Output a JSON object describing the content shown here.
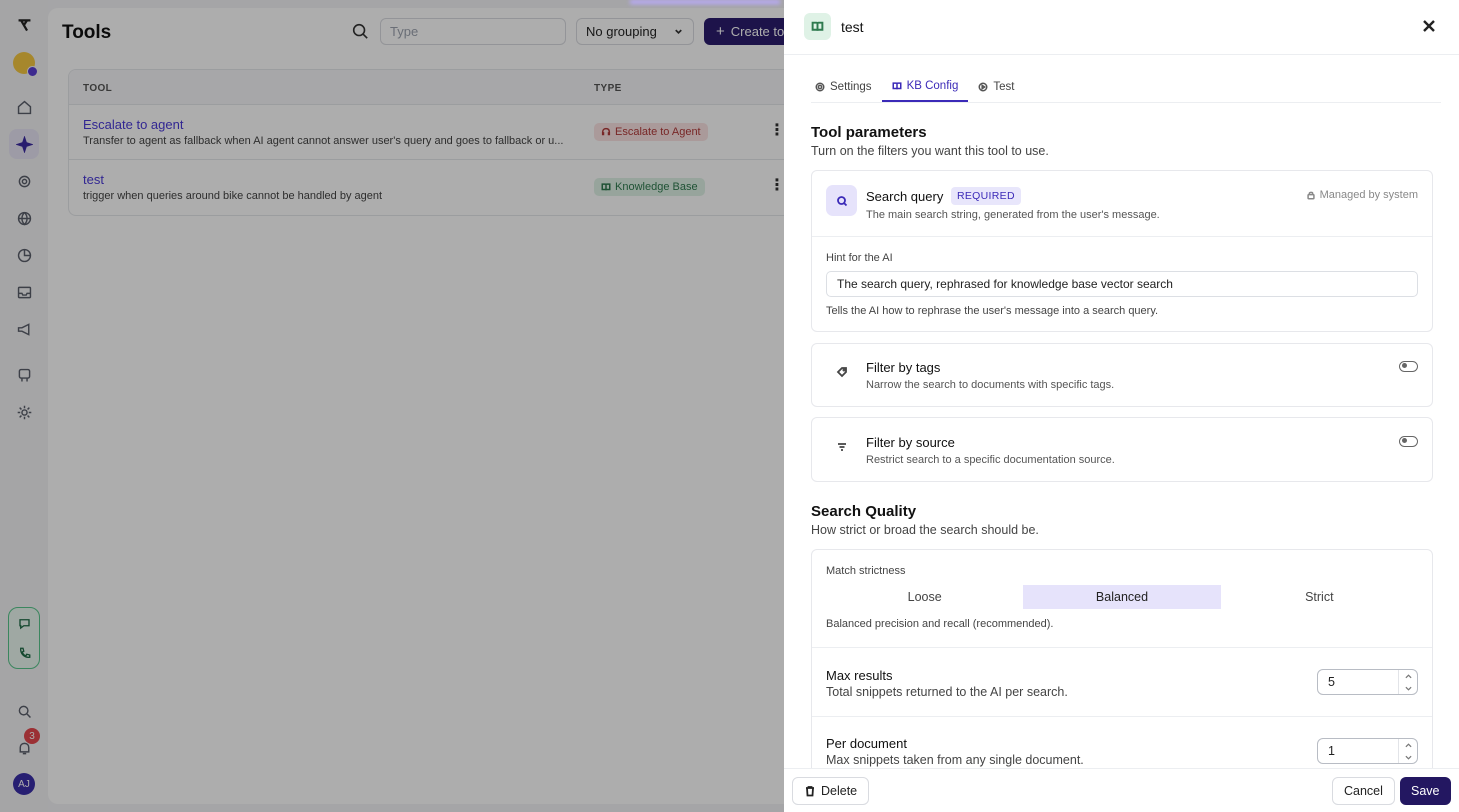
{
  "sidebar": {
    "notification_count": "3",
    "user_initials": "AJ"
  },
  "main": {
    "title": "Tools",
    "search_placeholder": "Type",
    "grouping": "No grouping",
    "create_label": "Create tool",
    "columns": [
      "TOOL",
      "TYPE"
    ],
    "rows": [
      {
        "name": "Escalate to agent",
        "desc": "Transfer to agent as fallback when AI agent cannot answer user's query and goes to fallback or u...",
        "type": "Escalate to Agent"
      },
      {
        "name": "test",
        "desc": "trigger when queries around bike cannot be handled by agent",
        "type": "Knowledge Base"
      }
    ]
  },
  "drawer": {
    "title": "test",
    "tabs": [
      "Settings",
      "KB Config",
      "Test"
    ],
    "params": {
      "title": "Tool parameters",
      "subtitle": "Turn on the filters you want this tool to use.",
      "search_query": {
        "title": "Search query",
        "badge": "REQUIRED",
        "managed": "Managed by system",
        "desc": "The main search string, generated from the user's message.",
        "hint_label": "Hint for the AI",
        "hint_value": "The search query, rephrased for knowledge base vector search",
        "hint_help": "Tells the AI how to rephrase the user's message into a search query."
      },
      "filter_tags": {
        "title": "Filter by tags",
        "desc": "Narrow the search to documents with specific tags."
      },
      "filter_source": {
        "title": "Filter by source",
        "desc": "Restrict search to a specific documentation source."
      }
    },
    "quality": {
      "title": "Search Quality",
      "subtitle": "How strict or broad the search should be.",
      "strictness_label": "Match strictness",
      "options": [
        "Loose",
        "Balanced",
        "Strict"
      ],
      "selected": "Balanced",
      "strictness_help": "Balanced precision and recall (recommended).",
      "max_results": {
        "title": "Max results",
        "desc": "Total snippets returned to the AI per search.",
        "value": "5"
      },
      "per_document": {
        "title": "Per document",
        "desc": "Max snippets taken from any single document.",
        "value": "1"
      }
    },
    "footer": {
      "delete": "Delete",
      "cancel": "Cancel",
      "save": "Save"
    }
  }
}
